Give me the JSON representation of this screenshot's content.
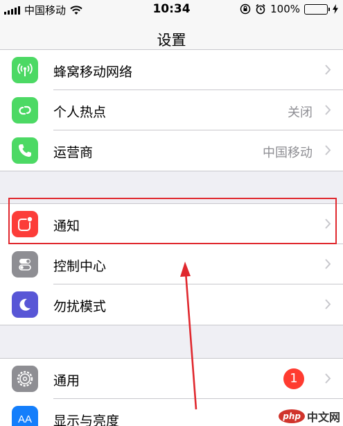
{
  "status_bar": {
    "carrier": "中国移动",
    "time": "10:34",
    "battery": "100%"
  },
  "nav": {
    "title": "设置"
  },
  "groups": [
    {
      "rows": [
        {
          "label": "蜂窝移动网络",
          "value": "",
          "icon": "antenna-icon",
          "color": "#4cd964"
        },
        {
          "label": "个人热点",
          "value": "关闭",
          "icon": "link-icon",
          "color": "#4cd964"
        },
        {
          "label": "运营商",
          "value": "中国移动",
          "icon": "phone-icon",
          "color": "#4cd964"
        }
      ]
    },
    {
      "rows": [
        {
          "label": "通知",
          "value": "",
          "icon": "notification-icon",
          "color": "#fc3d39"
        },
        {
          "label": "控制中心",
          "value": "",
          "icon": "switches-icon",
          "color": "#8e8e93"
        },
        {
          "label": "勿扰模式",
          "value": "",
          "icon": "moon-icon",
          "color": "#5856d6"
        }
      ]
    },
    {
      "rows": [
        {
          "label": "通用",
          "value": "",
          "badge": "1",
          "icon": "gear-icon",
          "color": "#8e8e93"
        },
        {
          "label": "显示与亮度",
          "value": "",
          "icon": "text-size-icon",
          "color": "#147efb",
          "icon_text": "AA"
        }
      ]
    }
  ],
  "watermark": {
    "logo": "php",
    "text": "中文网"
  },
  "colors": {
    "highlight": "#e0282e",
    "badge": "#ff3b30"
  }
}
